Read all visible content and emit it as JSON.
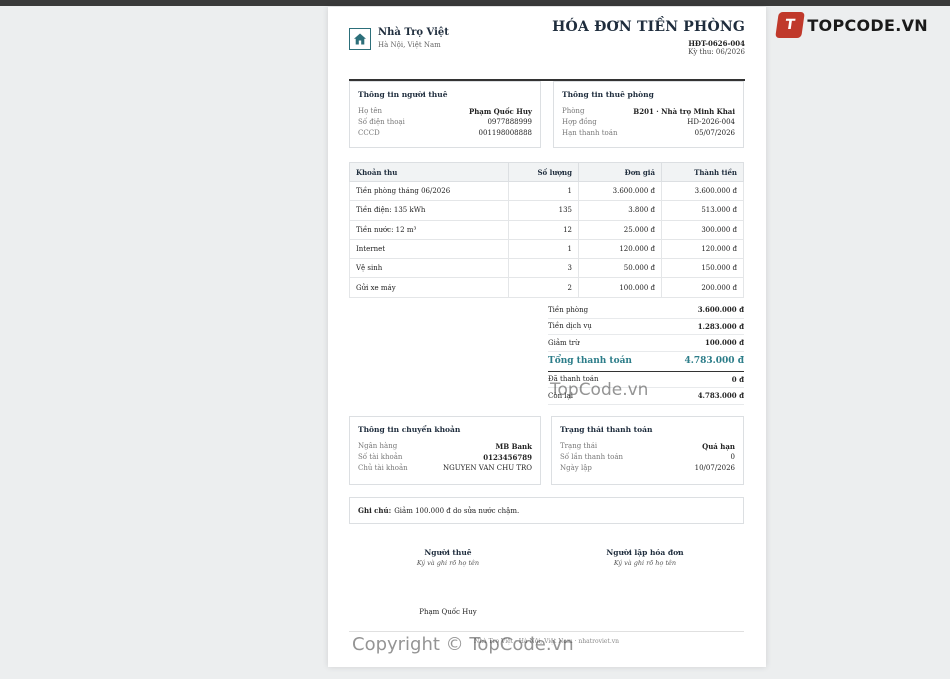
{
  "site": {
    "brand_mark": "T",
    "brand_text": "TOPCODE.VN"
  },
  "company": {
    "name": "Nhà Trọ Việt",
    "address": "Hà Nội, Việt Nam",
    "logo_icon": "house-icon"
  },
  "invoice": {
    "title": "HÓA ĐƠN TIỀN PHÒNG",
    "code": "HĐT-0626-004",
    "period": "Kỳ thu: 06/2026"
  },
  "tenant": {
    "title": "Thông tin người thuê",
    "rows": [
      {
        "k": "Họ tên",
        "v": "Phạm Quốc Huy"
      },
      {
        "k": "Số điện thoại",
        "v": "0977888999"
      },
      {
        "k": "CCCD",
        "v": "001198008888"
      }
    ]
  },
  "room": {
    "title": "Thông tin thuê phòng",
    "rows": [
      {
        "k": "Phòng",
        "v": "B201 · Nhà trọ Minh Khai"
      },
      {
        "k": "Hợp đồng",
        "v": "HD-2026-004"
      },
      {
        "k": "Hạn thanh toán",
        "v": "05/07/2026"
      }
    ]
  },
  "items": {
    "headers": [
      "Khoản thu",
      "Số lượng",
      "Đơn giá",
      "Thành tiền"
    ],
    "rows": [
      [
        "Tiền phòng tháng 06/2026",
        "1",
        "3.600.000 đ",
        "3.600.000 đ"
      ],
      [
        "Tiền điện: 135 kWh",
        "135",
        "3.800 đ",
        "513.000 đ"
      ],
      [
        "Tiền nước: 12 m³",
        "12",
        "25.000 đ",
        "300.000 đ"
      ],
      [
        "Internet",
        "1",
        "120.000 đ",
        "120.000 đ"
      ],
      [
        "Vệ sinh",
        "3",
        "50.000 đ",
        "150.000 đ"
      ],
      [
        "Gửi xe máy",
        "2",
        "100.000 đ",
        "200.000 đ"
      ]
    ]
  },
  "summary": {
    "rows": [
      {
        "k": "Tiền phòng",
        "v": "3.600.000 đ"
      },
      {
        "k": "Tiền dịch vụ",
        "v": "1.283.000 đ"
      },
      {
        "k": "Giảm trừ",
        "v": "100.000 đ"
      }
    ],
    "total": {
      "k": "Tổng thanh toán",
      "v": "4.783.000 đ"
    },
    "after": [
      {
        "k": "Đã thanh toán",
        "v": "0 đ"
      },
      {
        "k": "Còn lại",
        "v": "4.783.000 đ"
      }
    ]
  },
  "bank": {
    "title": "Thông tin chuyển khoản",
    "rows": [
      {
        "k": "Ngân hàng",
        "v": "MB Bank"
      },
      {
        "k": "Số tài khoản",
        "v": "0123456789"
      },
      {
        "k": "Chủ tài khoản",
        "v": "NGUYEN VAN CHU TRO"
      }
    ]
  },
  "status": {
    "title": "Trạng thái thanh toán",
    "rows": [
      {
        "k": "Trạng thái",
        "v": "Quá hạn"
      },
      {
        "k": "Số lần thanh toán",
        "v": "0"
      },
      {
        "k": "Ngày lập",
        "v": "10/07/2026"
      }
    ]
  },
  "note": {
    "label": "Ghi chú:",
    "text": "Giảm 100.000 đ do sửa nước chậm."
  },
  "signatures": {
    "tenant_role": "Người thuê",
    "tenant_hint": "Ký và ghi rõ họ tên",
    "tenant_name": "Phạm Quốc Huy",
    "issuer_role": "Người lập hóa đơn",
    "issuer_hint": "Ký và ghi rõ họ tên"
  },
  "footer": {
    "text": "Nhà Trọ Việt · Hà Nội, Việt Nam · nhatroviet.vn"
  },
  "watermarks": {
    "center": "TopCode.vn",
    "bottom": "Copyright © TopCode.vn"
  }
}
